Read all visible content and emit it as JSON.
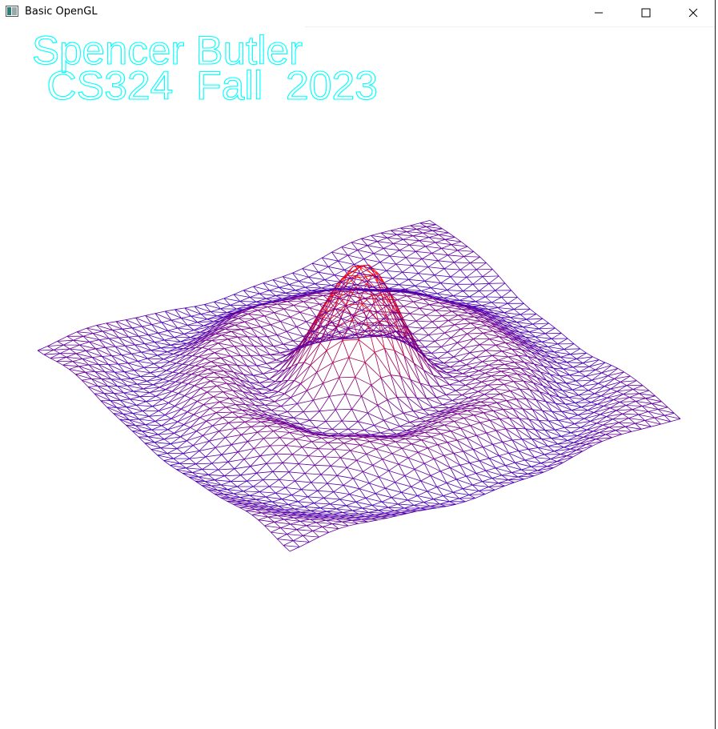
{
  "window": {
    "title": "Basic OpenGL",
    "controls": {
      "minimize": "minimize-icon",
      "maximize": "maximize-icon",
      "close": "close-icon"
    }
  },
  "overlay": {
    "line1": "Spencer  Butler",
    "line2": " CS324  Fall  2023",
    "color": "#00ffff"
  },
  "surface": {
    "render_mode": "wireframe",
    "high_color": "#ff0000",
    "low_color": "#0000ff",
    "mid_color": "#800080"
  }
}
